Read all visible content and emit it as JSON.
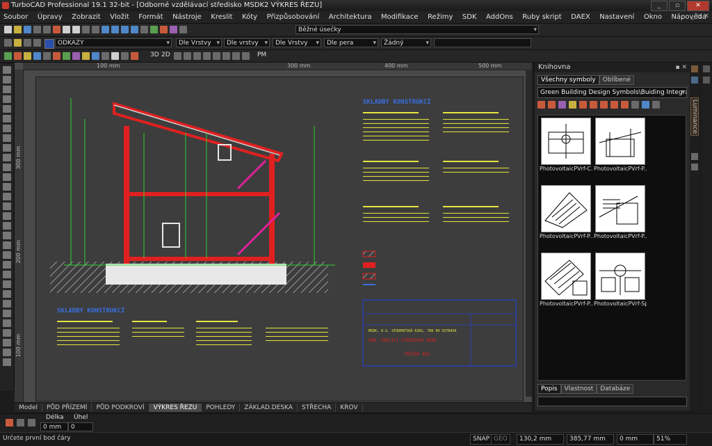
{
  "window": {
    "title": "TurboCAD Professional 19.1 32-bit - [Odborné vzdělávací středisko MSDK2 VÝKRES ŘEZU]",
    "buttons": [
      "_",
      "▫",
      "✕"
    ]
  },
  "menu": [
    "Soubor",
    "Úpravy",
    "Zobrazit",
    "Vložit",
    "Formát",
    "Nástroje",
    "Kreslit",
    "Kóty",
    "Přizpůsobování",
    "Architektura",
    "Modifikace",
    "Režimy",
    "SDK",
    "AddOns",
    "Ruby skript",
    "DAEX",
    "Nastavení",
    "Okno",
    "Nápověda"
  ],
  "toolbar1": {
    "line_style": "Běžné úsečky"
  },
  "toolbar2": {
    "layer": "ODKAZY",
    "color_by": "Dle Vrstvy",
    "line_by": "Dle vrstvy",
    "width_by": "Dle Vrstvy",
    "pen_by": "Dle pera",
    "none_value": "Žádný"
  },
  "toolbar3": {
    "labels": [
      "3D",
      "2D",
      "PM"
    ]
  },
  "rulers": {
    "top": [
      "100 mm",
      "300 mm",
      "400 mm",
      "500 mm"
    ],
    "left": [
      "300 mm",
      "200 mm",
      "100 mm"
    ]
  },
  "drawing": {
    "heading_right": "SKLADBY KONSTRUKCÍ",
    "heading_left": "SKLADBY KONSTRUKCÍ",
    "title_block": {
      "author": "MSDK, O.S. STUDENTSKÁ 6202, 708 00 OSTRAVA",
      "stamp": "ODB. ŠKOLÍCÍ STŘEDISKO MSDK",
      "sheet": "PŘÍČNÝ ŘEZ"
    }
  },
  "tabs": [
    "Model",
    "PŮD PŘÍZEMÍ",
    "PŮD PODKROVÍ",
    "VÝKRES ŘEZU",
    "POHLEDY",
    "ZÁKLAD.DESKA",
    "STŘECHA",
    "KROV"
  ],
  "active_tab": "VÝKRES ŘEZU",
  "library": {
    "title": "Knihovna",
    "tabs": [
      "Všechny symboly",
      "Oblíbené"
    ],
    "path": "Green Building Design Symbols\\Buiding Integrated Photov",
    "items": [
      "PhotovoltaicPVrf-C...",
      "PhotovoltaicPVrf-P...",
      "PhotovoltaicPVrf-P...",
      "PhotovoltaicPVrf-P...",
      "PhotovoltaicPVrf-P...",
      "PhotovoltaicPVrf-Sp..."
    ],
    "bottom_tabs": [
      "Popis",
      "Vlastnost",
      "Databáze"
    ],
    "side_label": "Luminance"
  },
  "inspector": {
    "length_label": "Délka",
    "length_value": "0 mm",
    "angle_label": "Úhel",
    "angle_value": "0"
  },
  "status": {
    "prompt": "Určete první bod čáry",
    "snap": "SNAP",
    "geo": "GEO",
    "x": "130,2 mm",
    "y": "385,77 mm",
    "z": "0 mm",
    "zoom": "51%"
  }
}
